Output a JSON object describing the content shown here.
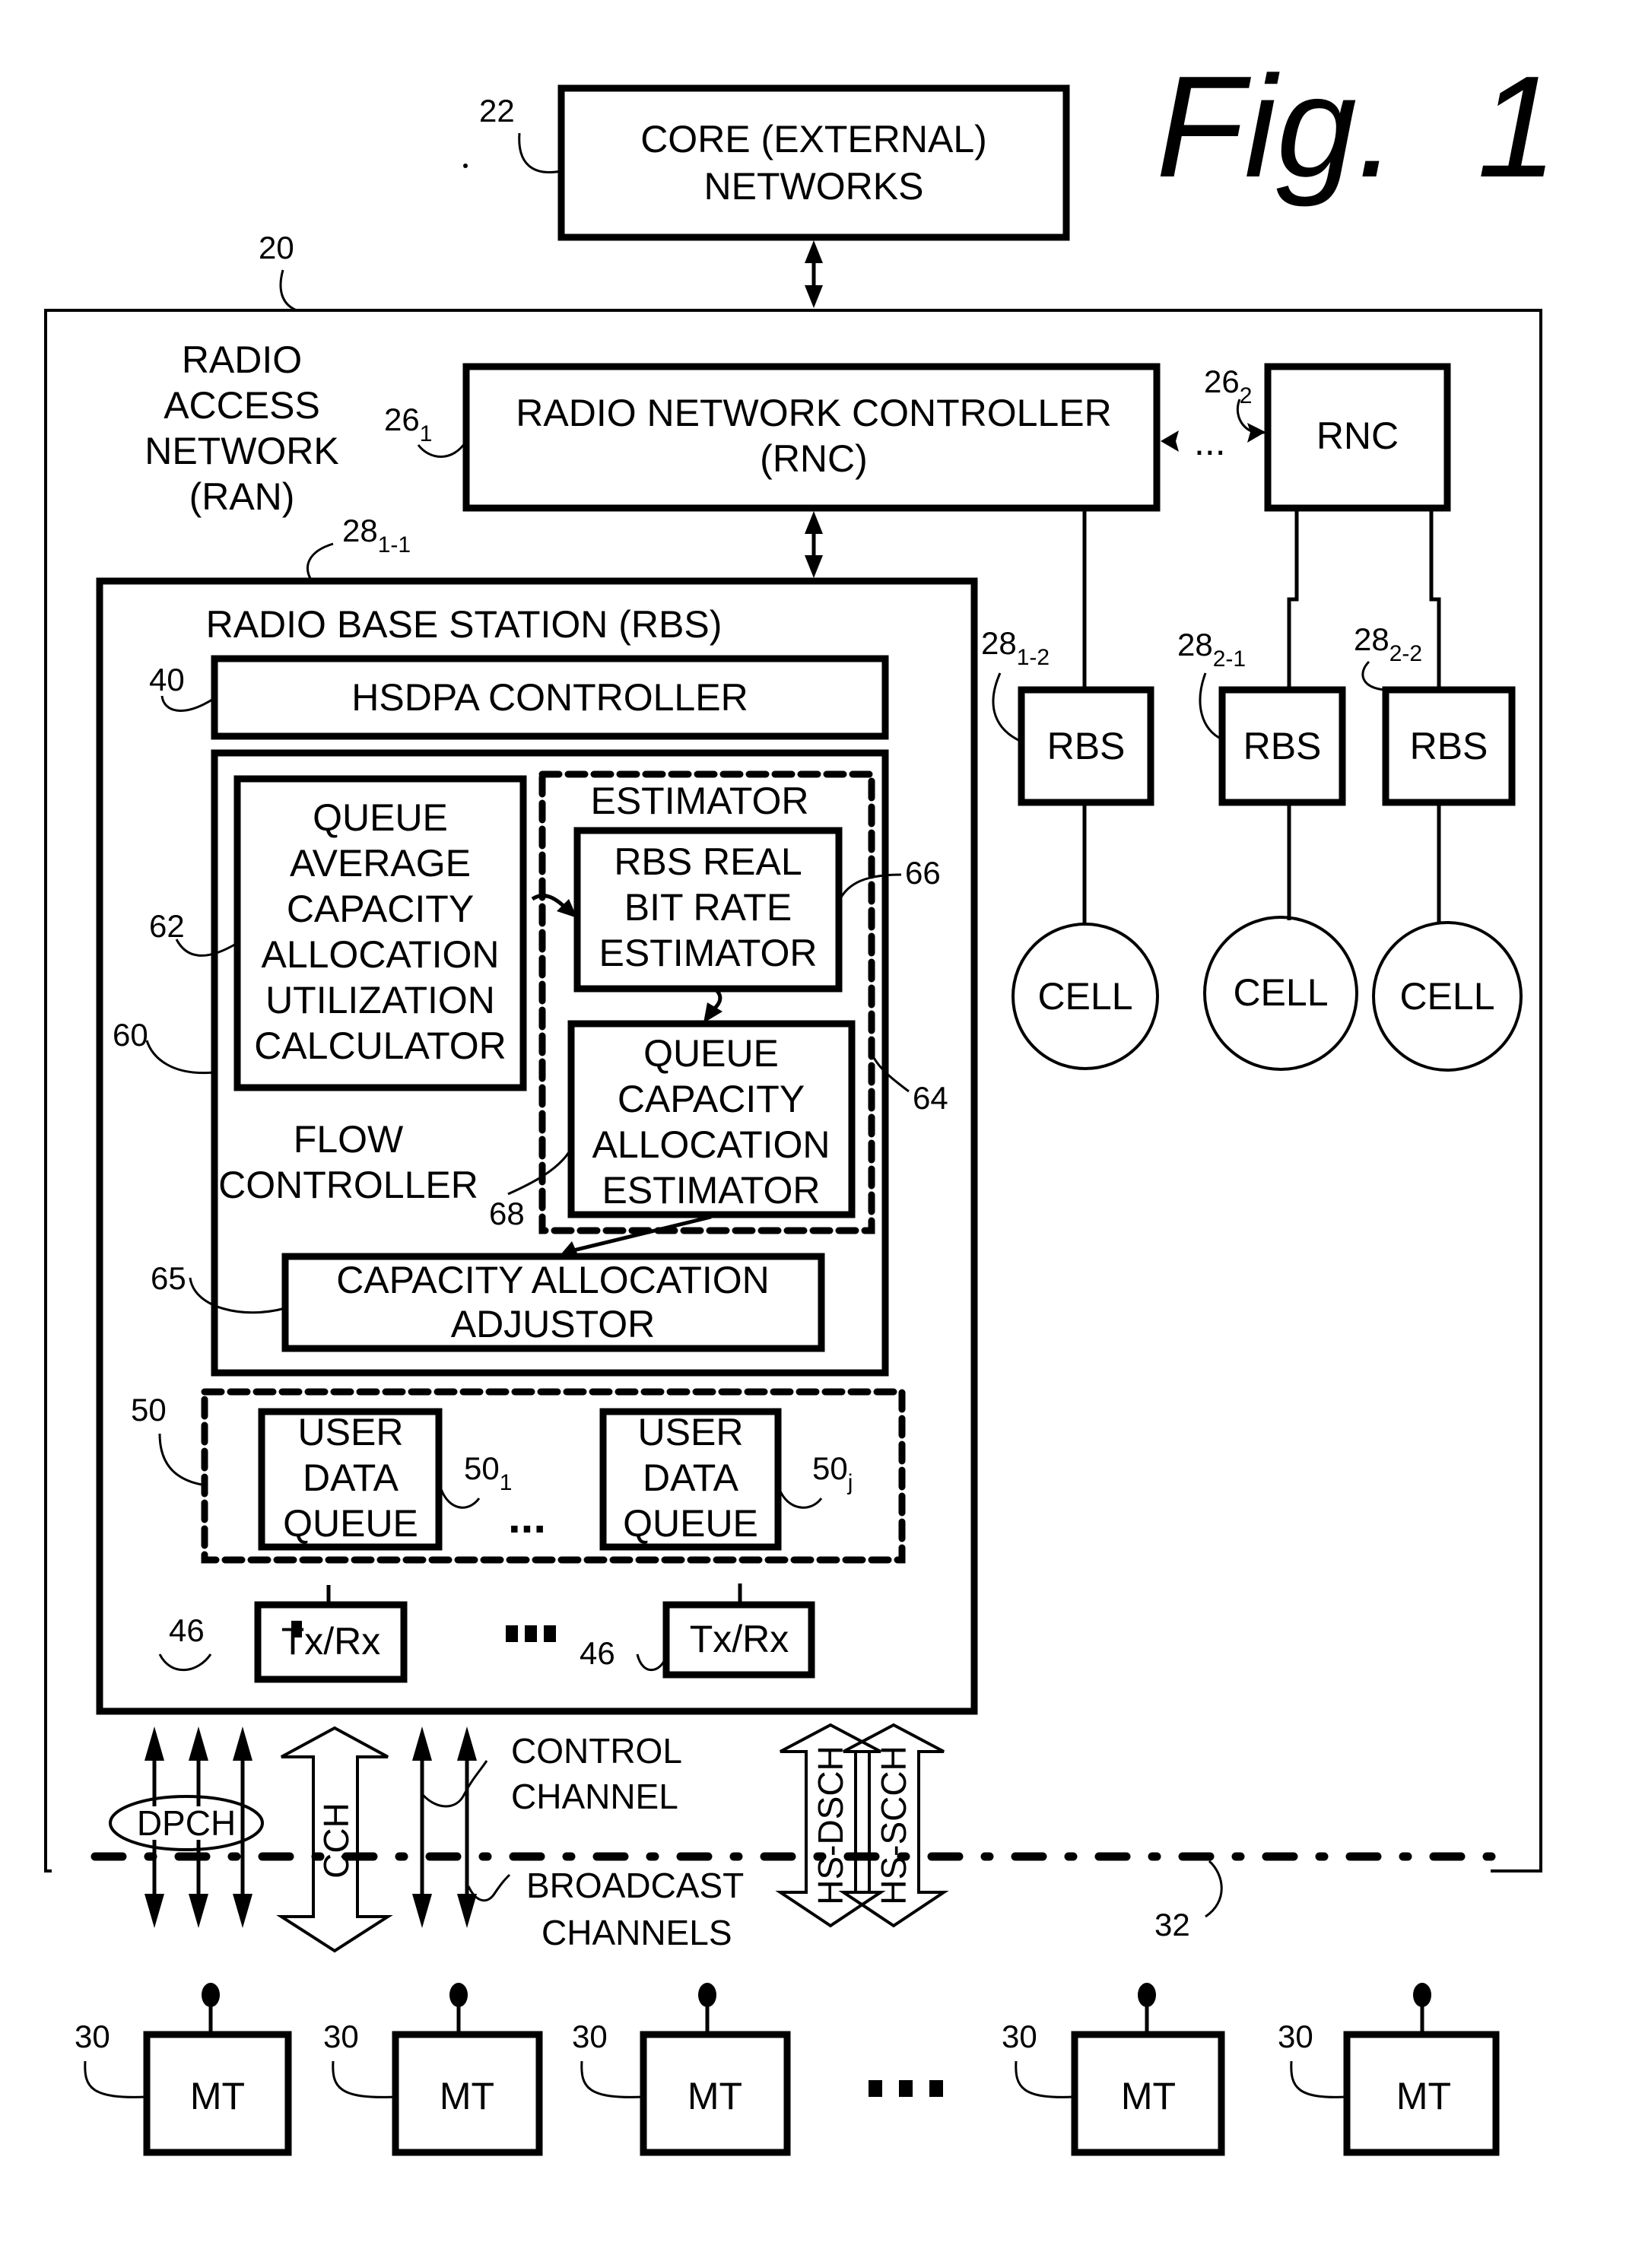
{
  "figure": {
    "title": "Fig.  1"
  },
  "core": {
    "line1": "CORE (EXTERNAL)",
    "line2": "NETWORKS",
    "ref": "22"
  },
  "ran": {
    "ref": "20",
    "line1": "RADIO",
    "line2": "ACCESS",
    "line3": "NETWORK",
    "line4": "(RAN)"
  },
  "rnc1": {
    "line1": "RADIO NETWORK CONTROLLER",
    "line2": "(RNC)",
    "ref_main": "26",
    "ref_sub": "1"
  },
  "rnc2": {
    "label": "RNC",
    "ref_main": "26",
    "ref_sub": "2",
    "ellipsis": "..."
  },
  "rbs_main": {
    "title": "RADIO BASE STATION (RBS)",
    "ref_main": "28",
    "ref_sub": "1-1"
  },
  "hsdpa": {
    "label": "HSDPA CONTROLLER",
    "ref": "40"
  },
  "flow_controller": {
    "ref": "60",
    "line1": "FLOW",
    "line2": "CONTROLLER"
  },
  "queue_avg": {
    "ref": "62",
    "lines": [
      "QUEUE",
      "AVERAGE",
      "CAPACITY",
      "ALLOCATION",
      "UTILIZATION",
      "CALCULATOR"
    ]
  },
  "estimator": {
    "label": "ESTIMATOR",
    "ref": "64"
  },
  "rbs_bitrate": {
    "ref": "66",
    "lines": [
      "RBS REAL",
      "BIT RATE",
      "ESTIMATOR"
    ]
  },
  "queue_cap_est": {
    "ref": "68",
    "lines": [
      "QUEUE",
      "CAPACITY",
      "ALLOCATION",
      "ESTIMATOR"
    ]
  },
  "adjustor": {
    "ref": "65",
    "line1": "CAPACITY ALLOCATION",
    "line2": "ADJUSTOR"
  },
  "queues": {
    "ref": "50",
    "items": [
      {
        "lines": [
          "USER",
          "DATA",
          "QUEUE"
        ],
        "ref_main": "50",
        "ref_sub": "1"
      },
      {
        "lines": [
          "USER",
          "DATA",
          "QUEUE"
        ],
        "ref_main": "50",
        "ref_sub": "j"
      }
    ],
    "ellipsis": "..."
  },
  "transceivers": {
    "items": [
      {
        "label": "Tx/Rx",
        "ref": "46"
      },
      {
        "label": "Tx/Rx",
        "ref": "46"
      }
    ]
  },
  "remote_rbs": [
    {
      "label": "RBS",
      "ref_main": "28",
      "ref_sub": "1-2",
      "cell": "CELL"
    },
    {
      "label": "RBS",
      "ref_main": "28",
      "ref_sub": "2-1",
      "cell": "CELL"
    },
    {
      "label": "RBS",
      "ref_main": "28",
      "ref_sub": "2-2",
      "cell": "CELL"
    }
  ],
  "channels": {
    "dpch": "DPCH",
    "cch": "CCH",
    "control_line1": "CONTROL",
    "control_line2": "CHANNEL",
    "broadcast_line1": "BROADCAST",
    "broadcast_line2": "CHANNELS",
    "hs_dsch": "HS-DSCH",
    "hs_scch": "HS-SCCH",
    "air_interface_ref": "32"
  },
  "mobile_terminals": {
    "items": [
      {
        "label": "MT",
        "ref": "30"
      },
      {
        "label": "MT",
        "ref": "30"
      },
      {
        "label": "MT",
        "ref": "30"
      },
      {
        "label": "MT",
        "ref": "30"
      },
      {
        "label": "MT",
        "ref": "30"
      }
    ]
  }
}
